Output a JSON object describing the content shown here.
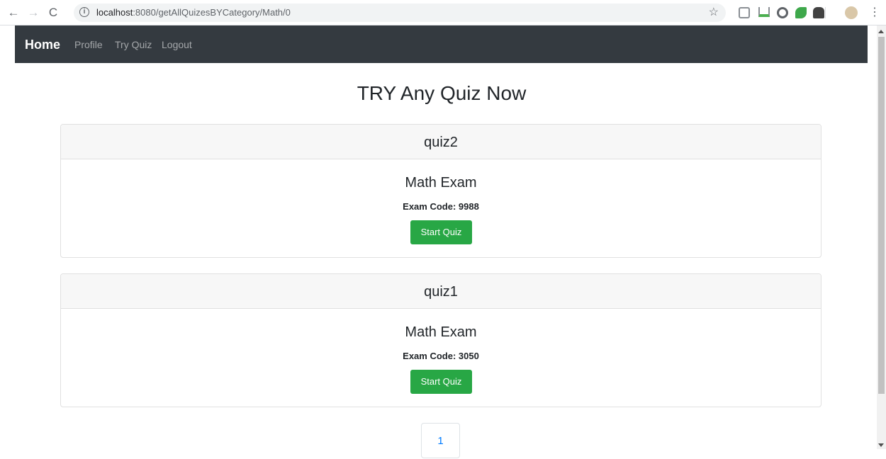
{
  "browser": {
    "url_host": "localhost",
    "url_path": ":8080/getAllQuizesBYCategory/Math/0",
    "extension_icons": [
      "camera-icon",
      "download-icon",
      "circle-extension-icon",
      "leaf-extension-icon",
      "android-icon"
    ]
  },
  "navbar": {
    "brand": "Home",
    "links": [
      "Profile",
      "Try Quiz",
      "Logout"
    ]
  },
  "main": {
    "title": "TRY Any Quiz Now",
    "quizzes": [
      {
        "name": "quiz2",
        "title": "Math Exam",
        "code": "Exam Code: 9988",
        "button": "Start Quiz"
      },
      {
        "name": "quiz1",
        "title": "Math Exam",
        "code": "Exam Code: 3050",
        "button": "Start Quiz"
      }
    ],
    "pagination": [
      "1"
    ]
  },
  "colors": {
    "navbar_bg": "#343a40",
    "success": "#28a745",
    "link": "#007bff"
  }
}
